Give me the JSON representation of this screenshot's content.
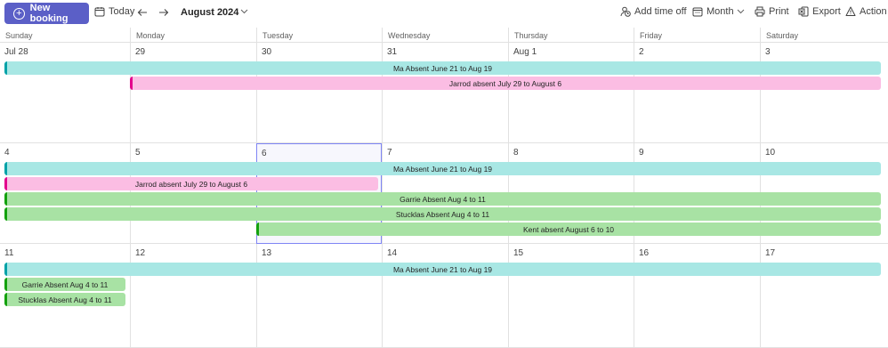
{
  "toolbar": {
    "new_booking": "New booking",
    "today": "Today",
    "month_title": "August 2024",
    "add_time_off": "Add time off",
    "view": "Month",
    "print": "Print",
    "export": "Export",
    "action": "Action it"
  },
  "weekdays": [
    "Sunday",
    "Monday",
    "Tuesday",
    "Wednesday",
    "Thursday",
    "Friday",
    "Saturday"
  ],
  "weeks": [
    [
      "Jul 28",
      "29",
      "30",
      "31",
      "Aug 1",
      "2",
      "3"
    ],
    [
      "4",
      "5",
      "6",
      "7",
      "8",
      "9",
      "10"
    ],
    [
      "11",
      "12",
      "13",
      "14",
      "15",
      "16",
      "17"
    ]
  ],
  "today_date": "6",
  "colors": {
    "accent": "#5b5fc7",
    "teal": "#00a2a8",
    "pink": "#e3008c",
    "green": "#13a10e"
  },
  "events": {
    "ma_week1": "Ma Absent June 21 to Aug 19",
    "jarrod_week1": "Jarrod absent July 29 to August 6",
    "ma_week2": "Ma Absent June 21 to Aug 19",
    "jarrod_week2": "Jarrod absent July 29 to August 6",
    "garrie_week2": "Garrie Absent Aug 4 to 11",
    "stucklas_week2": "Stucklas Absent Aug 4 to 11",
    "kent_week2": "Kent absent August 6 to 10",
    "ma_week3": "Ma Absent June 21 to Aug 19",
    "garrie_week3": "Garrie Absent Aug 4 to 11",
    "stucklas_week3": "Stucklas Absent Aug 4 to 11"
  }
}
